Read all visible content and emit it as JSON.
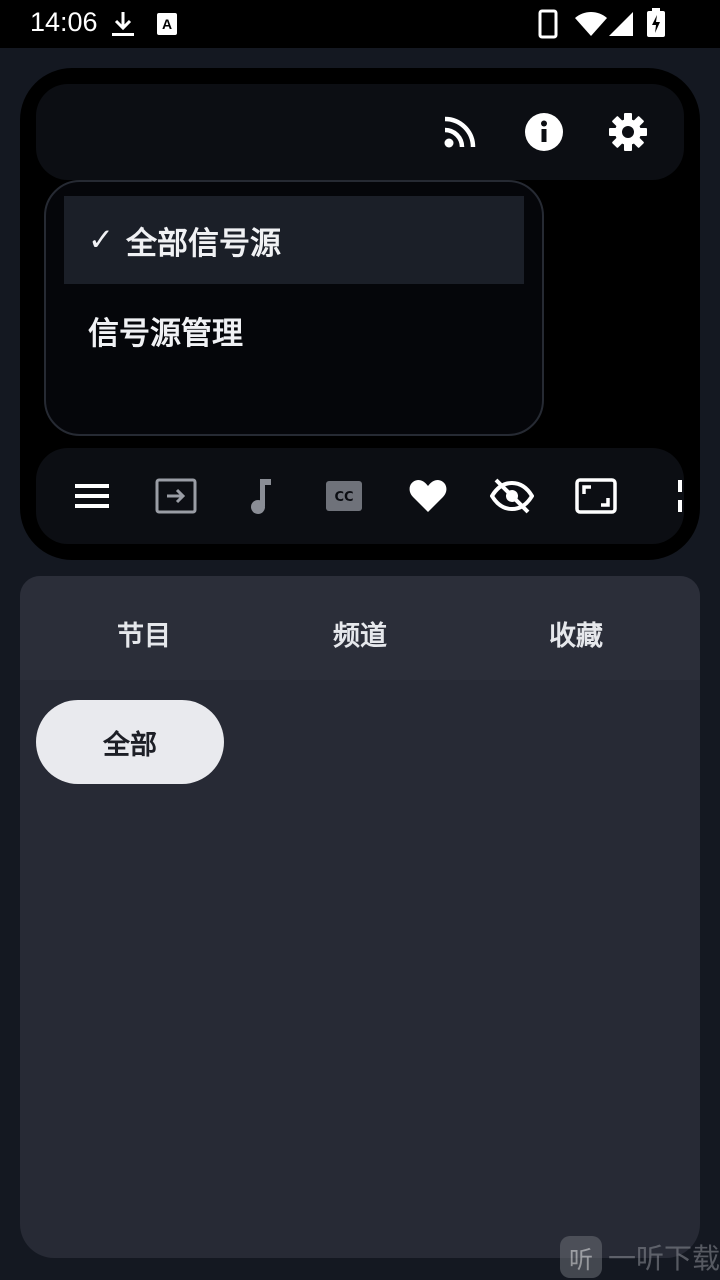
{
  "status_bar": {
    "time": "14:06",
    "left_icons": [
      "download-icon",
      "keyboard-a-icon"
    ],
    "right_icons": [
      "phone-icon",
      "wifi-icon",
      "signal-icon",
      "battery-charging-icon"
    ]
  },
  "top_toolbar": {
    "icons": [
      "rss-feed-icon",
      "info-icon",
      "settings-gear-icon"
    ]
  },
  "source_menu": {
    "items": [
      {
        "label": "全部信号源",
        "checked": true,
        "check_mark": "✓"
      },
      {
        "label": "信号源管理",
        "checked": false
      }
    ]
  },
  "control_bar": {
    "icons": [
      "menu-icon",
      "input-switch-icon",
      "music-note-icon",
      "closed-caption-icon",
      "heart-icon",
      "eye-off-icon",
      "aspect-ratio-icon",
      "more-vertical-icon"
    ]
  },
  "tabs": [
    {
      "label": "节目"
    },
    {
      "label": "频道"
    },
    {
      "label": "收藏"
    }
  ],
  "filter_chip": {
    "label": "全部"
  },
  "watermark": {
    "logo": "听",
    "text": "一听下载"
  },
  "colors": {
    "background": "#141821",
    "player_bg": "#000000",
    "panel_bg": "#272a35",
    "chip_bg": "#e9eaee",
    "selected_item_bg": "#1b1f28"
  }
}
